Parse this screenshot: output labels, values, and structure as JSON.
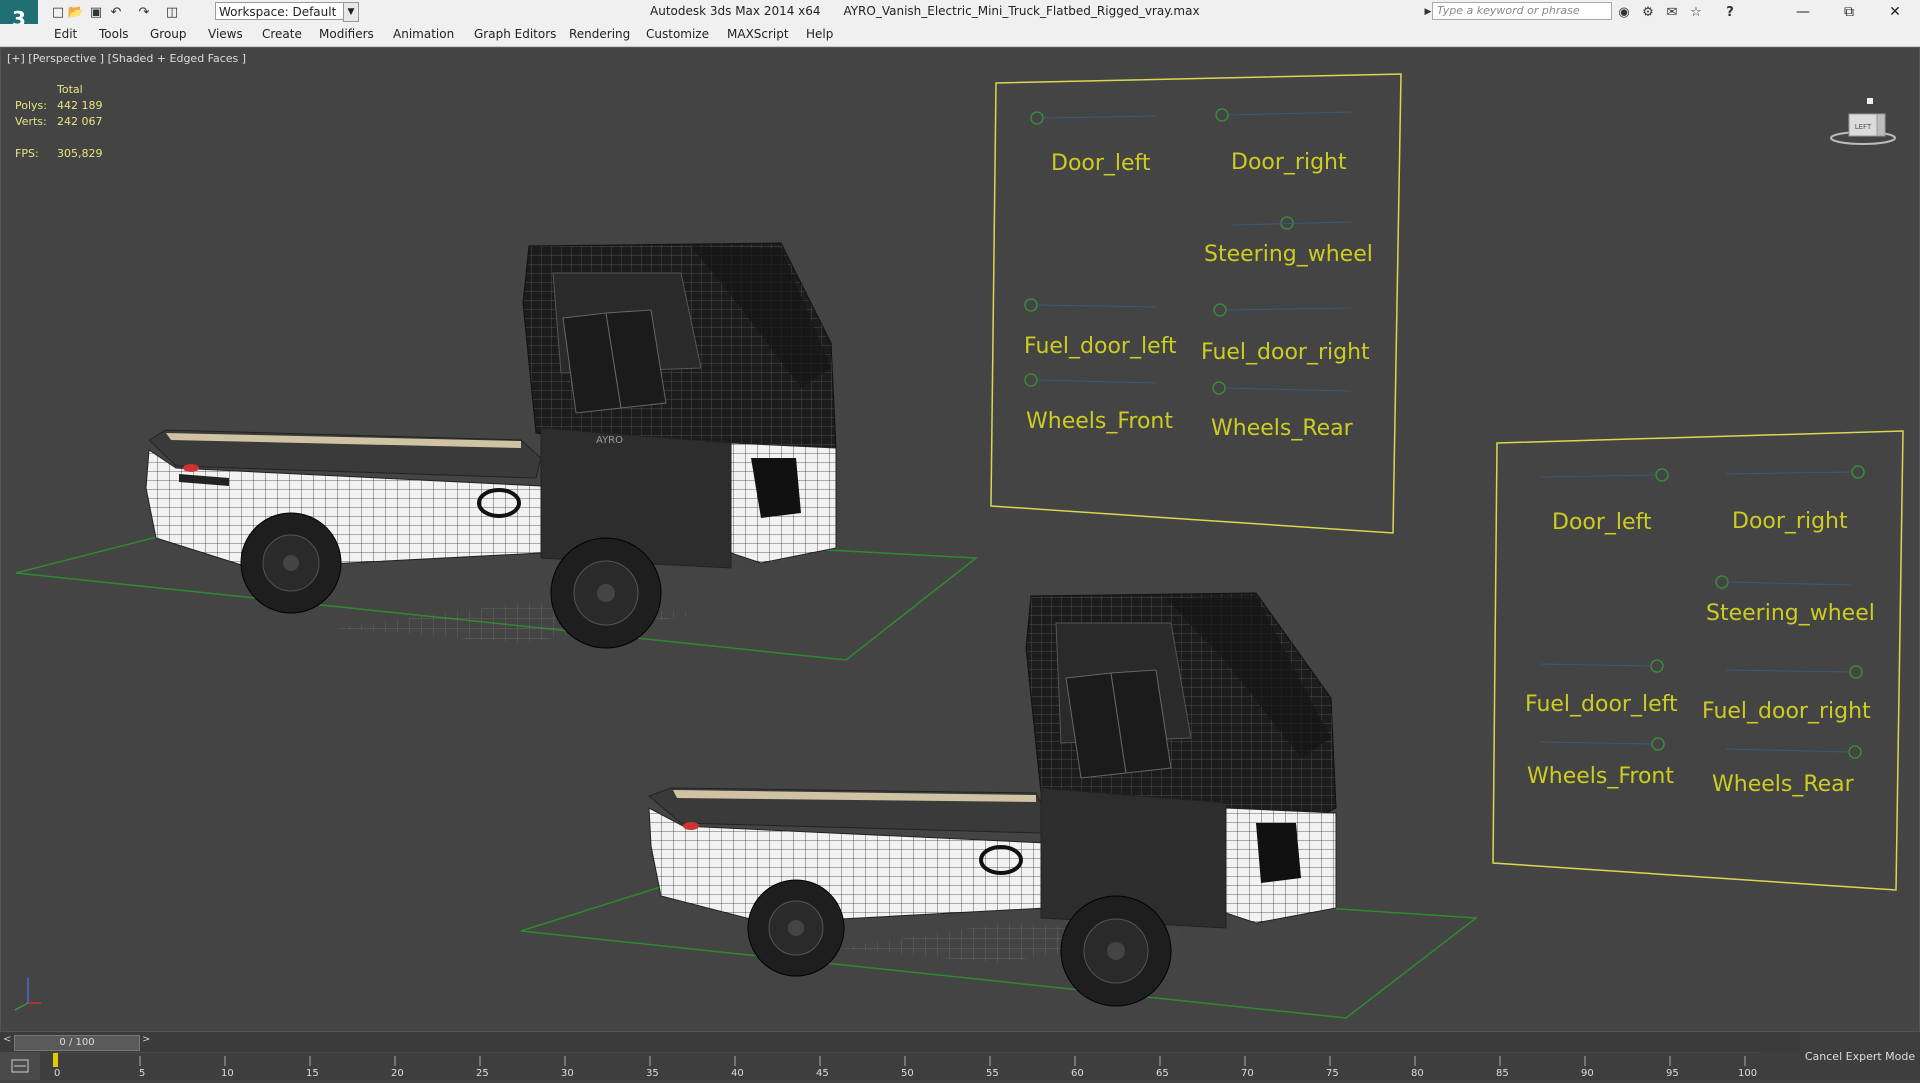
{
  "titlebar": {
    "workspace": "Workspace: Default",
    "app_title": "Autodesk 3ds Max  2014 x64",
    "file_name": "AYRO_Vanish_Electric_Mini_Truck_Flatbed_Rigged_vray.max",
    "search_placeholder": "Type a keyword or phrase"
  },
  "menu": [
    "Edit",
    "Tools",
    "Group",
    "Views",
    "Create",
    "Modifiers",
    "Animation",
    "Graph Editors",
    "Rendering",
    "Customize",
    "MAXScript",
    "Help"
  ],
  "viewport": {
    "label": "[+] [Perspective ] [Shaded + Edged Faces ]",
    "stats_header": "Total",
    "polys_label": "Polys:",
    "polys_value": "442 189",
    "verts_label": "Verts:",
    "verts_value": "242 067",
    "fps_label": "FPS:",
    "fps_value": "305,829",
    "viewcube_left": "LEFT"
  },
  "panels": [
    {
      "labels": [
        "Door_left",
        "Door_right",
        "Steering_wheel",
        "Fuel_door_left",
        "Fuel_door_right",
        "Wheels_Front",
        "Wheels_Rear"
      ]
    },
    {
      "labels": [
        "Door_left",
        "Door_right",
        "Steering_wheel",
        "Fuel_door_left",
        "Fuel_door_right",
        "Wheels_Front",
        "Wheels_Rear"
      ]
    }
  ],
  "truck_logo": "AYRO",
  "timeline": {
    "frame": "0 / 100",
    "ticks": [
      "0",
      "5",
      "10",
      "15",
      "20",
      "25",
      "30",
      "35",
      "40",
      "45",
      "50",
      "55",
      "60",
      "65",
      "70",
      "75",
      "80",
      "85",
      "90",
      "95",
      "100"
    ],
    "cancel_expert": "Cancel Expert Mode"
  }
}
